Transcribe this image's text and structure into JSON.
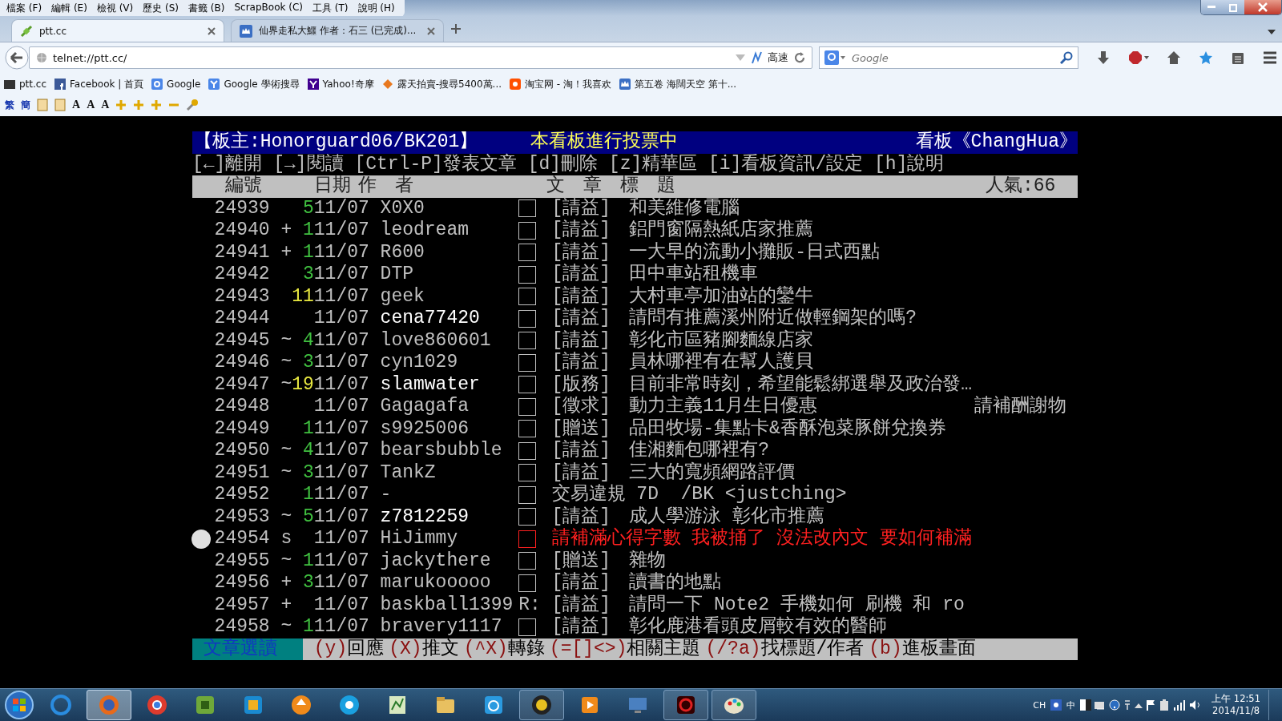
{
  "menu_bar": [
    "檔案 (F)",
    "編輯 (E)",
    "檢視 (V)",
    "歷史 (S)",
    "書籤 (B)",
    "ScrapBook (C)",
    "工具 (T)",
    "說明 (H)"
  ],
  "tabs": [
    {
      "label": "ptt.cc",
      "selected": true
    },
    {
      "label": "仙界走私大鱷 作者：石三 (已完成)...",
      "selected": false
    }
  ],
  "address_bar": {
    "value": "telnet://ptt.cc/",
    "speed_label": "高速"
  },
  "search": {
    "placeholder": "Google"
  },
  "bookmarks": [
    "ptt.cc",
    "Facebook | 首頁",
    "Google",
    "Google 學術搜尋",
    "Yahoo!奇摩",
    "露天拍賣-搜尋5400萬...",
    "淘宝网 - 淘！我喜欢",
    "第五卷 海闊天空 第十..."
  ],
  "scrapbook_toolbar": {
    "convert_buttons": [
      "繁",
      "簡"
    ],
    "font_buttons": [
      "A",
      "A",
      "A"
    ]
  },
  "terminal": {
    "title_bar": {
      "moderator": "【板主:Honorguard06/BK201】",
      "notice": "本看板進行投票中",
      "board": "看板《ChangHua》"
    },
    "help_line": "[←]離開 [→]閱讀 [Ctrl-P]發表文章 [d]刪除 [z]精華區 [i]看板資訊/設定 [h]說明",
    "columns": [
      "編號",
      "日期",
      "作　者",
      "文　章　標　題"
    ],
    "popularity": "人氣:66",
    "rows": [
      {
        "number": "24939",
        "count": "5",
        "color": "#40c040",
        "date": "11/07",
        "author": "X0X0",
        "bright": false,
        "category": "[請益]",
        "title": "和美維修電腦",
        "selected": false
      },
      {
        "number": "24940",
        "mark": "+",
        "count": "1",
        "color": "#40c040",
        "date": "11/07",
        "author": "leodream",
        "bright": false,
        "category": "[請益]",
        "title": "鋁門窗隔熱紙店家推薦",
        "selected": false
      },
      {
        "number": "24941",
        "mark": "+",
        "count": "1",
        "color": "#40c040",
        "date": "11/07",
        "author": "R600",
        "bright": false,
        "category": "[請益]",
        "title": "一大早的流動小攤販-日式西點",
        "selected": false
      },
      {
        "number": "24942",
        "count": "3",
        "color": "#40c040",
        "date": "11/07",
        "author": "DTP",
        "bright": false,
        "category": "[請益]",
        "title": "田中車站租機車",
        "selected": false
      },
      {
        "number": "24943",
        "count": "11",
        "color": "#e8e840",
        "date": "11/07",
        "author": "geek",
        "bright": false,
        "category": "[請益]",
        "title": "大村車亭加油站的鑾牛",
        "selected": false
      },
      {
        "number": "24944",
        "date": "11/07",
        "author": "cena77420",
        "bright": true,
        "category": "[請益]",
        "title": "請問有推薦溪州附近做輕鋼架的嗎?",
        "selected": false
      },
      {
        "number": "24945",
        "mark": "~",
        "count": "4",
        "color": "#40c040",
        "date": "11/07",
        "author": "love860601",
        "bright": false,
        "category": "[請益]",
        "title": "彰化市區豬腳麵線店家",
        "selected": false
      },
      {
        "number": "24946",
        "mark": "~",
        "count": "3",
        "color": "#40c040",
        "date": "11/07",
        "author": "cyn1029",
        "bright": false,
        "category": "[請益]",
        "title": "員林哪裡有在幫人護貝",
        "selected": false
      },
      {
        "number": "24947",
        "mark": "~",
        "count": "19",
        "color": "#e8e840",
        "date": "11/07",
        "author": "slamwater",
        "bright": true,
        "category": "[版務]",
        "title": "目前非常時刻，希望能鬆綁選舉及政治發…",
        "selected": false
      },
      {
        "number": "24948",
        "date": "11/07",
        "author": "Gagagafa",
        "bright": false,
        "category": "[徵求]",
        "title": "動力主義11月生日優惠",
        "note": "請補酬謝物",
        "selected": false
      },
      {
        "number": "24949",
        "count": "1",
        "color": "#40c040",
        "date": "11/07",
        "author": "s9925006",
        "bright": false,
        "category": "[贈送]",
        "title": "品田牧場-集點卡&香酥泡菜豚餅兌換券",
        "selected": false
      },
      {
        "number": "24950",
        "mark": "~",
        "count": "4",
        "color": "#40c040",
        "date": "11/07",
        "author": "bearsbubble",
        "bright": false,
        "category": "[請益]",
        "title": "佳湘麵包哪裡有?",
        "selected": false
      },
      {
        "number": "24951",
        "mark": "~",
        "count": "3",
        "color": "#40c040",
        "date": "11/07",
        "author": "TankZ",
        "bright": false,
        "category": "[請益]",
        "title": "三大的寬頻網路評價",
        "selected": false
      },
      {
        "number": "24952",
        "count": "1",
        "color": "#40c040",
        "date": "11/07",
        "author": "-",
        "bright": false,
        "title": "交易違規 7D  /BK <justching>",
        "selected": false
      },
      {
        "number": "24953",
        "mark": "~",
        "count": "5",
        "color": "#40c040",
        "date": "11/07",
        "author": "z7812259",
        "bright": true,
        "category": "[請益]",
        "title": "成人學游泳 彰化市推薦",
        "selected": false
      },
      {
        "number": "24954",
        "mark": "s",
        "date": "11/07",
        "author": "HiJimmy",
        "bright": false,
        "title": "請補滿心得字數 我被捅了 沒法改內文 要如何補滿",
        "selected": true
      },
      {
        "number": "24955",
        "mark": "~",
        "count": "1",
        "color": "#40c040",
        "date": "11/07",
        "author": "jackythere",
        "bright": false,
        "category": "[贈送]",
        "title": "雜物",
        "selected": false
      },
      {
        "number": "24956",
        "mark": "+",
        "count": "3",
        "color": "#40c040",
        "date": "11/07",
        "author": "marukooooo",
        "bright": false,
        "category": "[請益]",
        "title": "讀書的地點",
        "selected": false
      },
      {
        "number": "24957",
        "mark": "+",
        "date": "11/07",
        "author": "baskball1399",
        "bright": false,
        "reply": "R:",
        "category": "[請益]",
        "title": "請問一下 Note2 手機如何 刷機 和 ro",
        "selected": false
      },
      {
        "number": "24958",
        "mark": "~",
        "count": "1",
        "color": "#40c040",
        "date": "11/07",
        "author": "bravery1117",
        "bright": false,
        "category": "[請益]",
        "title": "彰化鹿港看頭皮屑較有效的醫師",
        "selected": false
      }
    ],
    "footer": {
      "mode": "文章選讀",
      "commands": [
        {
          "key": "(y)",
          "label": "回應"
        },
        {
          "key": "(X)",
          "label": "推文"
        },
        {
          "key": "(^X)",
          "label": "轉錄"
        },
        {
          "key": "(=[]<>)",
          "label": "相關主題"
        },
        {
          "key": "(/?a)",
          "label": "找標題/作者"
        },
        {
          "key": "(b)",
          "label": "進板畫面"
        }
      ]
    }
  },
  "taskbar": {
    "apps": [
      {
        "open": false,
        "selected": false
      },
      {
        "open": true,
        "selected": true
      },
      {
        "open": false,
        "selected": false
      },
      {
        "open": false,
        "selected": false
      },
      {
        "open": false,
        "selected": false
      },
      {
        "open": false,
        "selected": false
      },
      {
        "open": false,
        "selected": false
      },
      {
        "open": false,
        "selected": false
      },
      {
        "open": false,
        "selected": false
      },
      {
        "open": false,
        "selected": false
      },
      {
        "open": true,
        "selected": false
      },
      {
        "open": false,
        "selected": false
      },
      {
        "open": false,
        "selected": false
      },
      {
        "open": true,
        "selected": false
      },
      {
        "open": true,
        "selected": false
      }
    ],
    "language": "CH",
    "input_mode": "中",
    "time": "上午 12:51",
    "date": "2014/11/8"
  }
}
